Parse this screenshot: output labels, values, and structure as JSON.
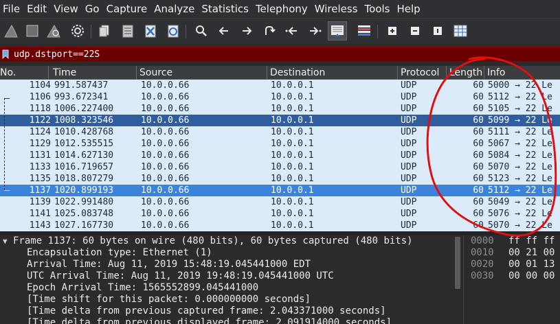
{
  "menu": [
    "File",
    "Edit",
    "View",
    "Go",
    "Capture",
    "Analyze",
    "Statistics",
    "Telephony",
    "Wireless",
    "Tools",
    "Help"
  ],
  "filter": {
    "value": "udp.dstport==22S"
  },
  "columns": [
    "No.",
    "Time",
    "Source",
    "Destination",
    "Protocol",
    "Length",
    "Info"
  ],
  "packets": [
    {
      "no": "1104",
      "time": "991.587437",
      "src": "10.0.0.66",
      "dst": "10.0.0.1",
      "proto": "UDP",
      "len": "60",
      "info": "5000 → 22 Le"
    },
    {
      "no": "1106",
      "time": "993.672341",
      "src": "10.0.0.66",
      "dst": "10.0.0.1",
      "proto": "UDP",
      "len": "60",
      "info": "5112 → 22 Le"
    },
    {
      "no": "1118",
      "time": "1006.227400",
      "src": "10.0.0.66",
      "dst": "10.0.0.1",
      "proto": "UDP",
      "len": "60",
      "info": "5105 → 22 Le"
    },
    {
      "no": "1122",
      "time": "1008.323546",
      "src": "10.0.0.66",
      "dst": "10.0.0.1",
      "proto": "UDP",
      "len": "60",
      "info": "5099 → 22 Le"
    },
    {
      "no": "1124",
      "time": "1010.428768",
      "src": "10.0.0.66",
      "dst": "10.0.0.1",
      "proto": "UDP",
      "len": "60",
      "info": "5111 → 22 Le"
    },
    {
      "no": "1129",
      "time": "1012.535515",
      "src": "10.0.0.66",
      "dst": "10.0.0.1",
      "proto": "UDP",
      "len": "60",
      "info": "5067 → 22 Le"
    },
    {
      "no": "1131",
      "time": "1014.627130",
      "src": "10.0.0.66",
      "dst": "10.0.0.1",
      "proto": "UDP",
      "len": "60",
      "info": "5084 → 22 Le"
    },
    {
      "no": "1133",
      "time": "1016.719657",
      "src": "10.0.0.66",
      "dst": "10.0.0.1",
      "proto": "UDP",
      "len": "60",
      "info": "5070 → 22 Le"
    },
    {
      "no": "1135",
      "time": "1018.807279",
      "src": "10.0.0.66",
      "dst": "10.0.0.1",
      "proto": "UDP",
      "len": "60",
      "info": "5123 → 22 Le"
    },
    {
      "no": "1137",
      "time": "1020.899193",
      "src": "10.0.0.66",
      "dst": "10.0.0.1",
      "proto": "UDP",
      "len": "60",
      "info": "5112 → 22 Le"
    },
    {
      "no": "1139",
      "time": "1022.991480",
      "src": "10.0.0.66",
      "dst": "10.0.0.1",
      "proto": "UDP",
      "len": "60",
      "info": "5049 → 22 Le"
    },
    {
      "no": "1141",
      "time": "1025.083748",
      "src": "10.0.0.66",
      "dst": "10.0.0.1",
      "proto": "UDP",
      "len": "60",
      "info": "5076 → 22 Le"
    },
    {
      "no": "1143",
      "time": "1027.167730",
      "src": "10.0.0.66",
      "dst": "10.0.0.1",
      "proto": "UDP",
      "len": "60",
      "info": "5070 → 22 Le"
    }
  ],
  "details": [
    "Frame 1137: 60 bytes on wire (480 bits), 60 bytes captured (480 bits)",
    "Encapsulation type: Ethernet (1)",
    "Arrival Time: Aug 11, 2019 15:48:19.045441000 EDT",
    "UTC Arrival Time: Aug 11, 2019 19:48:19.045441000 UTC",
    "Epoch Arrival Time: 1565552899.045441000",
    "[Time shift for this packet: 0.000000000 seconds]",
    "[Time delta from previous captured frame: 2.043371000 seconds]",
    "[Time delta from previous displayed frame: 2.091914000 seconds]"
  ],
  "bytes": [
    {
      "offset": "0000",
      "hex": "ff ff ff"
    },
    {
      "offset": "0010",
      "hex": "00 21 00"
    },
    {
      "offset": "0020",
      "hex": "00 01 13"
    },
    {
      "offset": "0030",
      "hex": "00 00 00"
    }
  ],
  "colors": {
    "row_bg": "#dcebfa",
    "selected_row": "#3c83dc",
    "marked_row": "#2f5d9d",
    "filter_invalid": "#6b0000",
    "annotation": "#e01010"
  }
}
